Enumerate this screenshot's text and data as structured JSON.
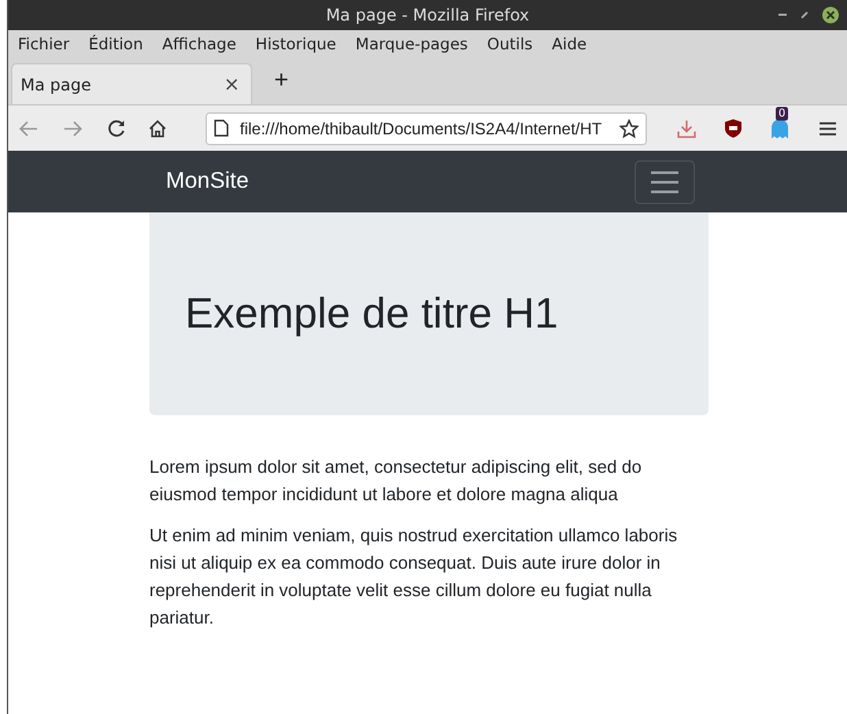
{
  "window": {
    "title": "Ma page - Mozilla Firefox"
  },
  "menu": [
    "Fichier",
    "Édition",
    "Affichage",
    "Historique",
    "Marque-pages",
    "Outils",
    "Aide"
  ],
  "tabs": [
    {
      "label": "Ma page",
      "close": "×",
      "selected": true
    }
  ],
  "new_tab": "+",
  "address_bar": {
    "value": "file:///home/thibault/Documents/IS2A4/Internet/HT"
  },
  "extension_badge": "0",
  "site": {
    "brand": "MonSite",
    "jumbotron": {
      "title": "Exemple de titre H1"
    },
    "paragraphs": [
      "Lorem ipsum dolor sit amet, consectetur adipiscing elit, sed do eiusmod tempor incididunt ut labore et dolore magna aliqua",
      "Ut enim ad minim veniam, quis nostrud exercitation ullamco laboris nisi ut aliquip ex ea commodo consequat. Duis aute irure dolor in reprehenderit in voluptate velit esse cillum dolore eu fugiat nulla pariatur."
    ]
  }
}
